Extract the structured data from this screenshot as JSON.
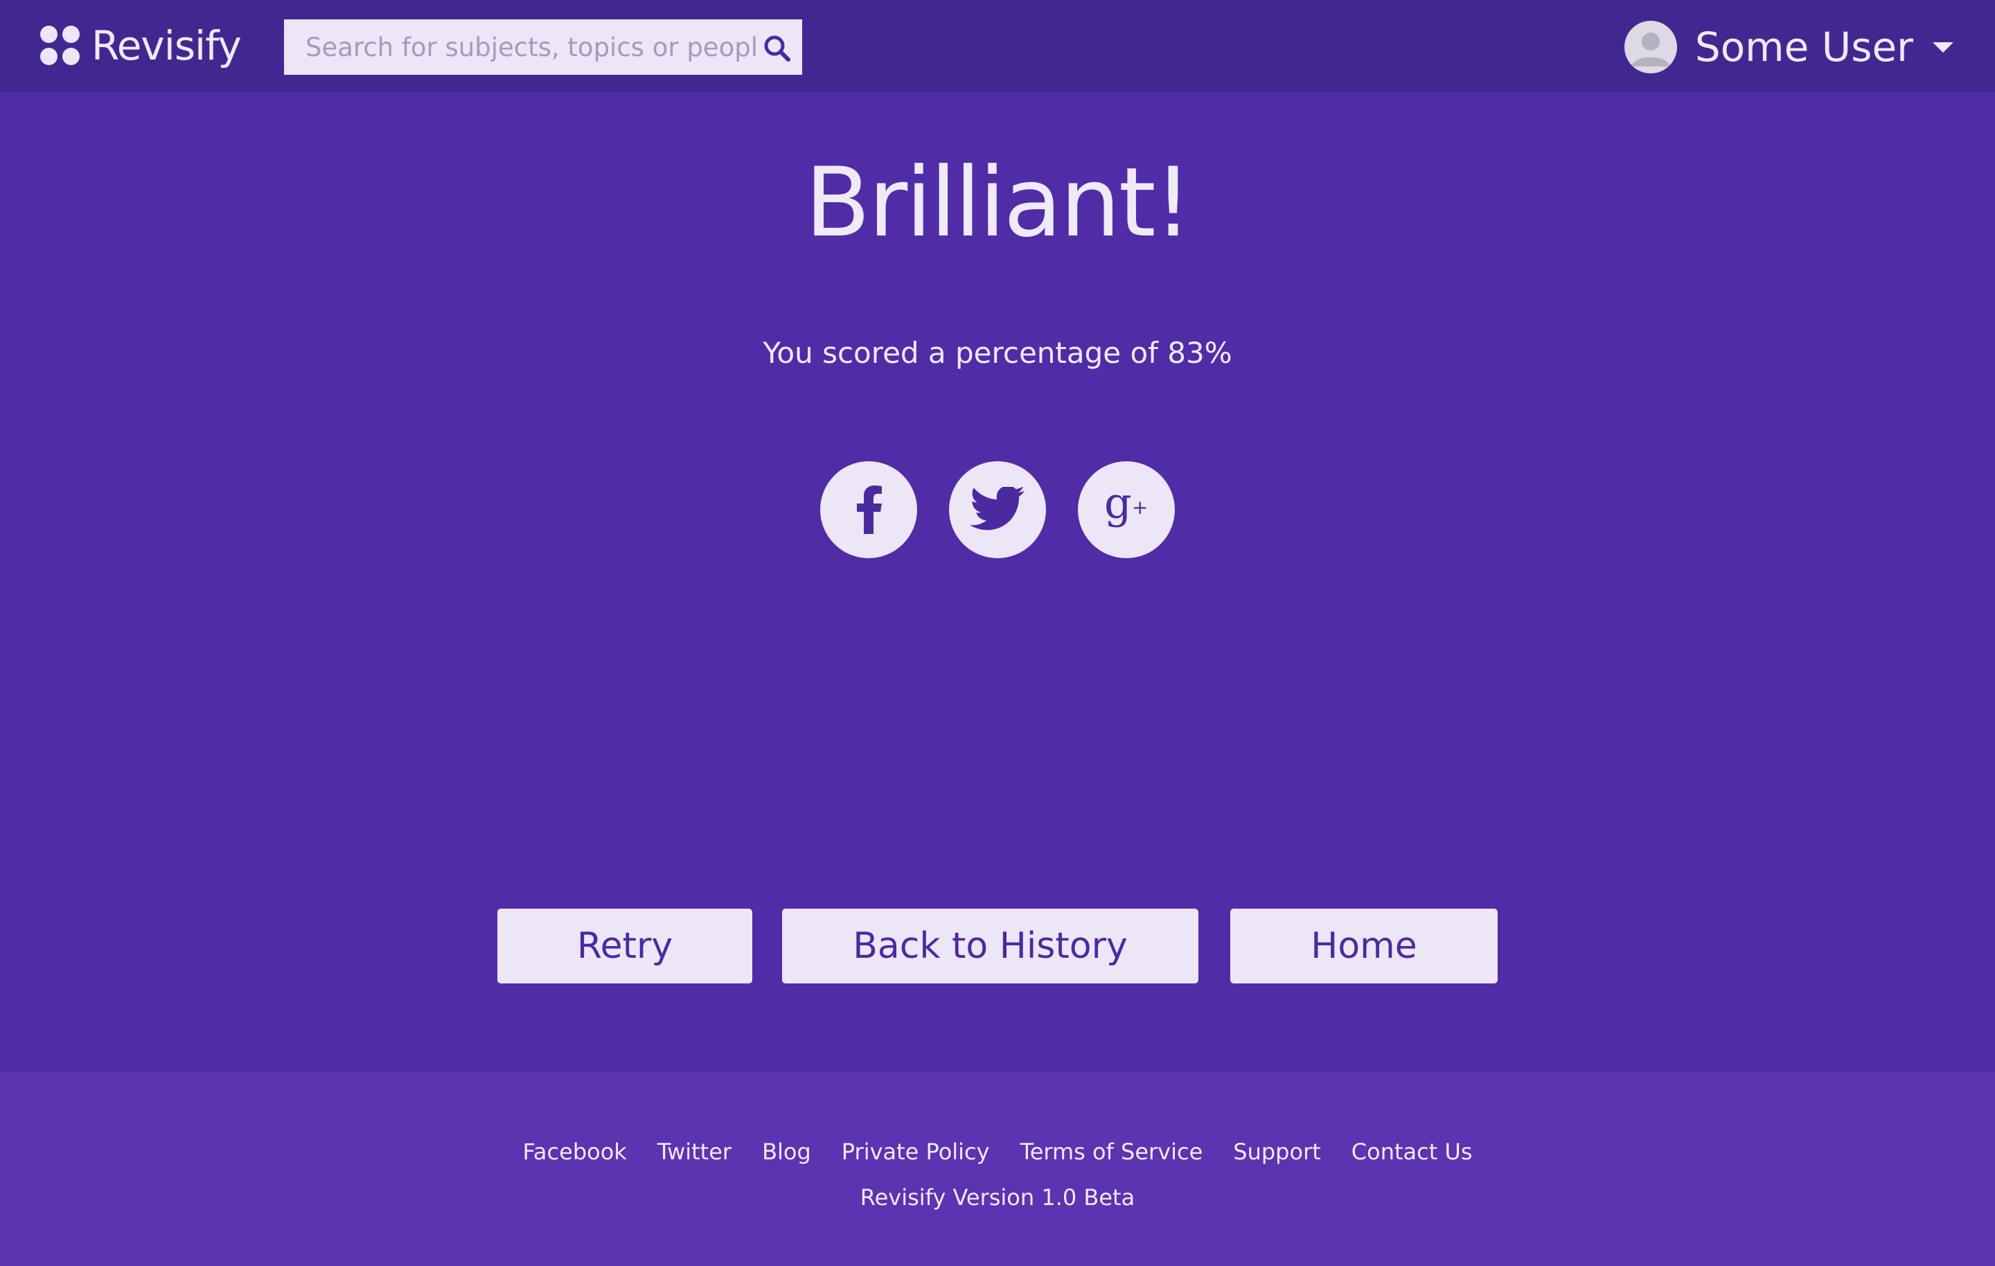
{
  "header": {
    "brand": "Revisify",
    "search": {
      "placeholder": "Search for subjects, topics or people",
      "value": ""
    },
    "user": {
      "name": "Some User"
    }
  },
  "result": {
    "headline": "Brilliant!",
    "score_text": "You scored a percentage of 83%",
    "score_percent": 83
  },
  "share": [
    "facebook-icon",
    "twitter-icon",
    "google-plus-icon"
  ],
  "actions": {
    "retry": "Retry",
    "history": "Back to History",
    "home": "Home"
  },
  "footer": {
    "links": [
      "Facebook",
      "Twitter",
      "Blog",
      "Private Policy",
      "Terms of Service",
      "Support",
      "Contact Us"
    ],
    "version": "Revisify Version 1.0 Beta"
  },
  "colors": {
    "header_bg": "#432791",
    "main_bg": "#502ca7",
    "footer_bg": "#5c33b0",
    "button_bg": "#ece6f6",
    "button_text": "#4b2aa0"
  }
}
